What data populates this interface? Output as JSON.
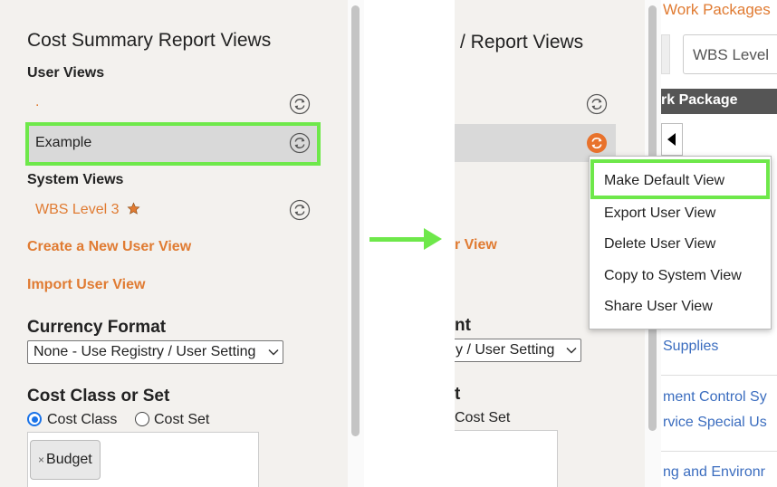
{
  "left": {
    "title": "Cost Summary Report Views",
    "user_views_header": "User Views",
    "user_view_items": [
      ".",
      "Example"
    ],
    "system_views_header": "System Views",
    "system_view_item": "WBS Level 3",
    "create_link": "Create a New User View",
    "import_link": "Import User View",
    "currency_header": "Currency Format",
    "currency_value": "None - Use Registry / User Setting",
    "cost_class_header": "Cost Class or Set",
    "radio_cost_class": "Cost Class",
    "radio_cost_set": "Cost Set",
    "radio_selected": "Cost Class",
    "chip_label": "Budget",
    "chip_remove": "×"
  },
  "right": {
    "title_partial": "/ Report Views",
    "link_partial": "r View",
    "currency_partial": "nt",
    "currency_value_partial": "y / User Setting",
    "cost_partial": "t",
    "radio_partial": "Cost Set"
  },
  "grid": {
    "title": "Work Packages",
    "wbs_select": "WBS Level",
    "header": "rk Package",
    "rows": [
      "Supplies",
      "ment Control Sy",
      "rvice Special Us",
      "ng and Environr"
    ]
  },
  "context_menu": {
    "items": [
      "Make Default View",
      "Export User View",
      "Delete User View",
      "Copy to System View",
      "Share User View"
    ],
    "highlighted": "Make Default View"
  },
  "colors": {
    "accent_orange": "#e07b32",
    "highlight_green": "#6ee84a",
    "link_blue": "#3b6dbf"
  }
}
